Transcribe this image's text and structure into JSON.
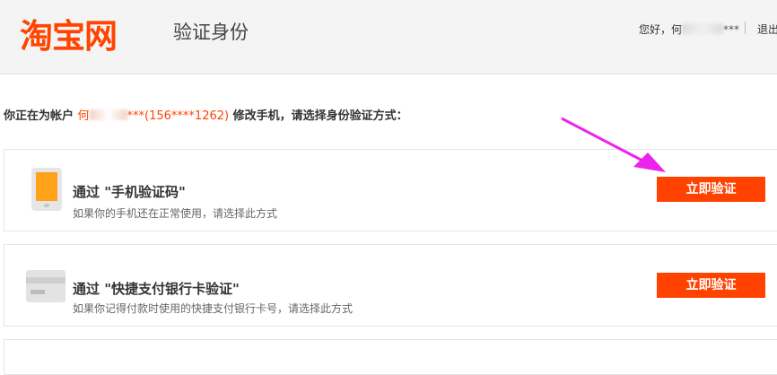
{
  "header": {
    "logo_text": "淘宝网",
    "page_title": "验证身份",
    "greeting_prefix": "您好，何",
    "greeting_mask": "***",
    "logout_label": "退出"
  },
  "prompt": {
    "prefix": "你正在为帐户 ",
    "account_name": "何",
    "account_mask": "***(156****1262)",
    "suffix": " 修改手机，请选择身份验证方式："
  },
  "methods": [
    {
      "title": "通过 \"手机验证码\"",
      "description": "如果你的手机还在正常使用，请选择此方式",
      "button_label": "立即验证",
      "icon": "phone-icon"
    },
    {
      "title": "通过 \"快捷支付银行卡验证\"",
      "description": "如果你记得付款时使用的快捷支付银行卡号，请选择此方式",
      "button_label": "立即验证",
      "icon": "bank-card-icon"
    }
  ],
  "colors": {
    "brand": "#ff4400",
    "button": "#ff4200",
    "annotation_arrow": "#ee22ee"
  }
}
